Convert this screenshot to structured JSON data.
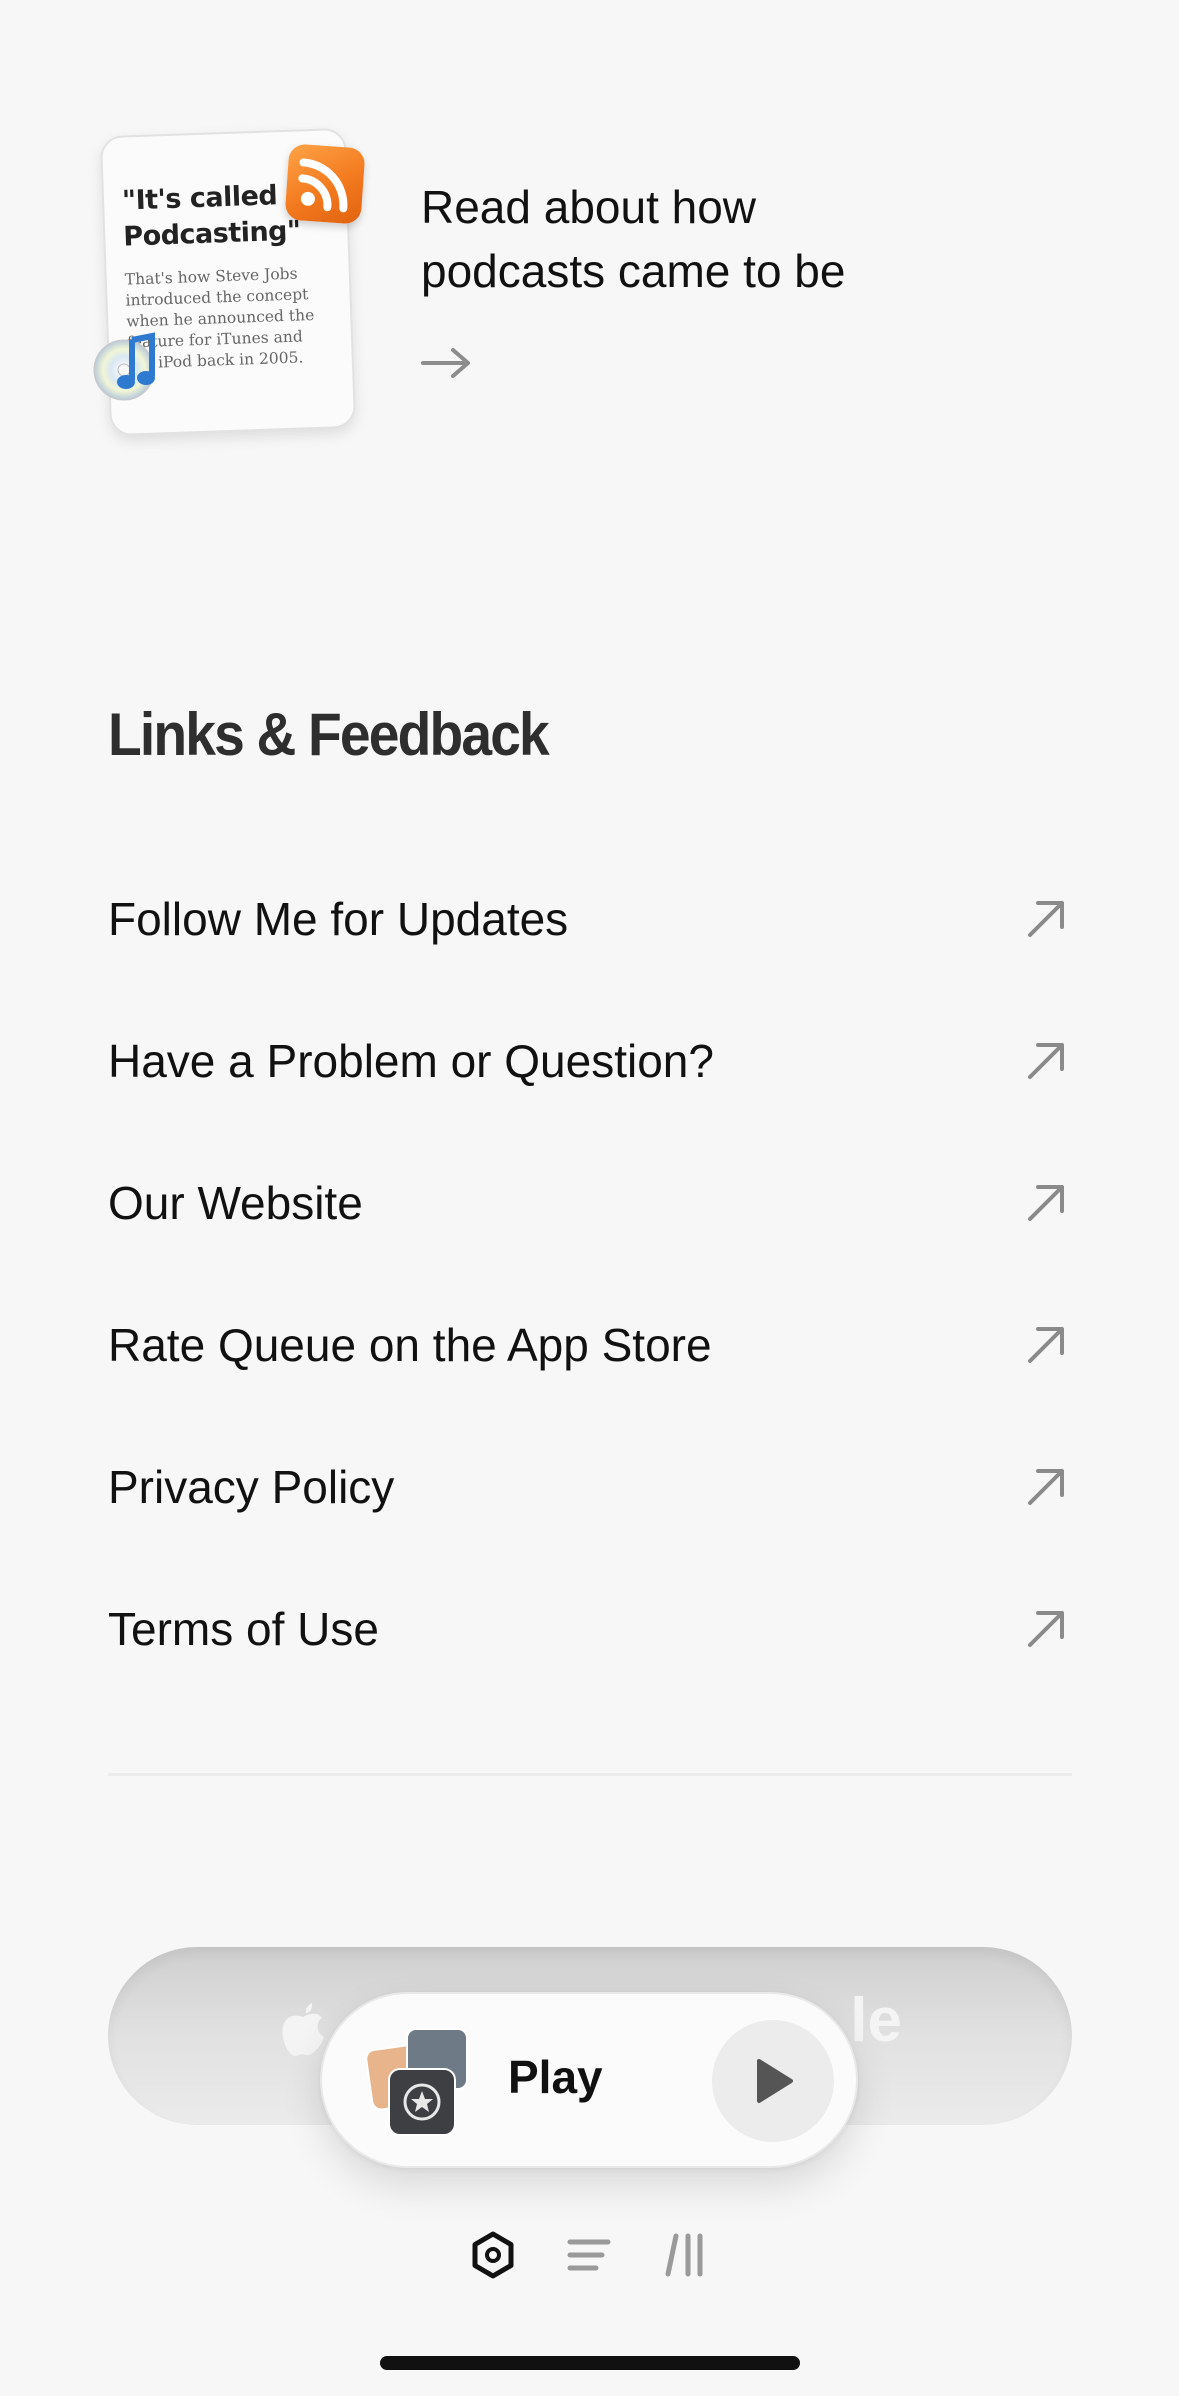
{
  "promo": {
    "card_quote_line1": "\"It's called",
    "card_quote_line2": "Podcasting\"",
    "card_body": "That's how Steve Jobs introduced the concept when he announced the feature for iTunes and the iPod back in 2005.",
    "headline_line1": "Read about how",
    "headline_line2": "podcasts came to be",
    "icons": [
      "rss-icon",
      "itunes-cd-icon",
      "arrow-right-icon"
    ]
  },
  "links_section": {
    "title": "Links & Feedback",
    "items": [
      {
        "label": "Follow Me for Updates",
        "icon": "external-link-icon"
      },
      {
        "label": "Have a Problem or Question?",
        "icon": "external-link-icon"
      },
      {
        "label": "Our Website",
        "icon": "external-link-icon"
      },
      {
        "label": "Rate Queue on the App Store",
        "icon": "external-link-icon"
      },
      {
        "label": "Privacy Policy",
        "icon": "external-link-icon"
      },
      {
        "label": "Terms of Use",
        "icon": "external-link-icon"
      }
    ]
  },
  "background_pill": {
    "visible_text": "le",
    "icon": "apple-icon"
  },
  "player": {
    "label": "Play",
    "icon": "play-icon"
  },
  "tabbar": {
    "tabs": [
      {
        "name": "home",
        "icon": "hexagon-icon",
        "active": true
      },
      {
        "name": "queue",
        "icon": "list-icon",
        "active": false
      },
      {
        "name": "library",
        "icon": "library-icon",
        "active": false
      }
    ]
  },
  "colors": {
    "background": "#f7f7f7",
    "rss_orange": "#f37a1f",
    "text": "#111111",
    "muted_icon": "#9a9a9a"
  }
}
